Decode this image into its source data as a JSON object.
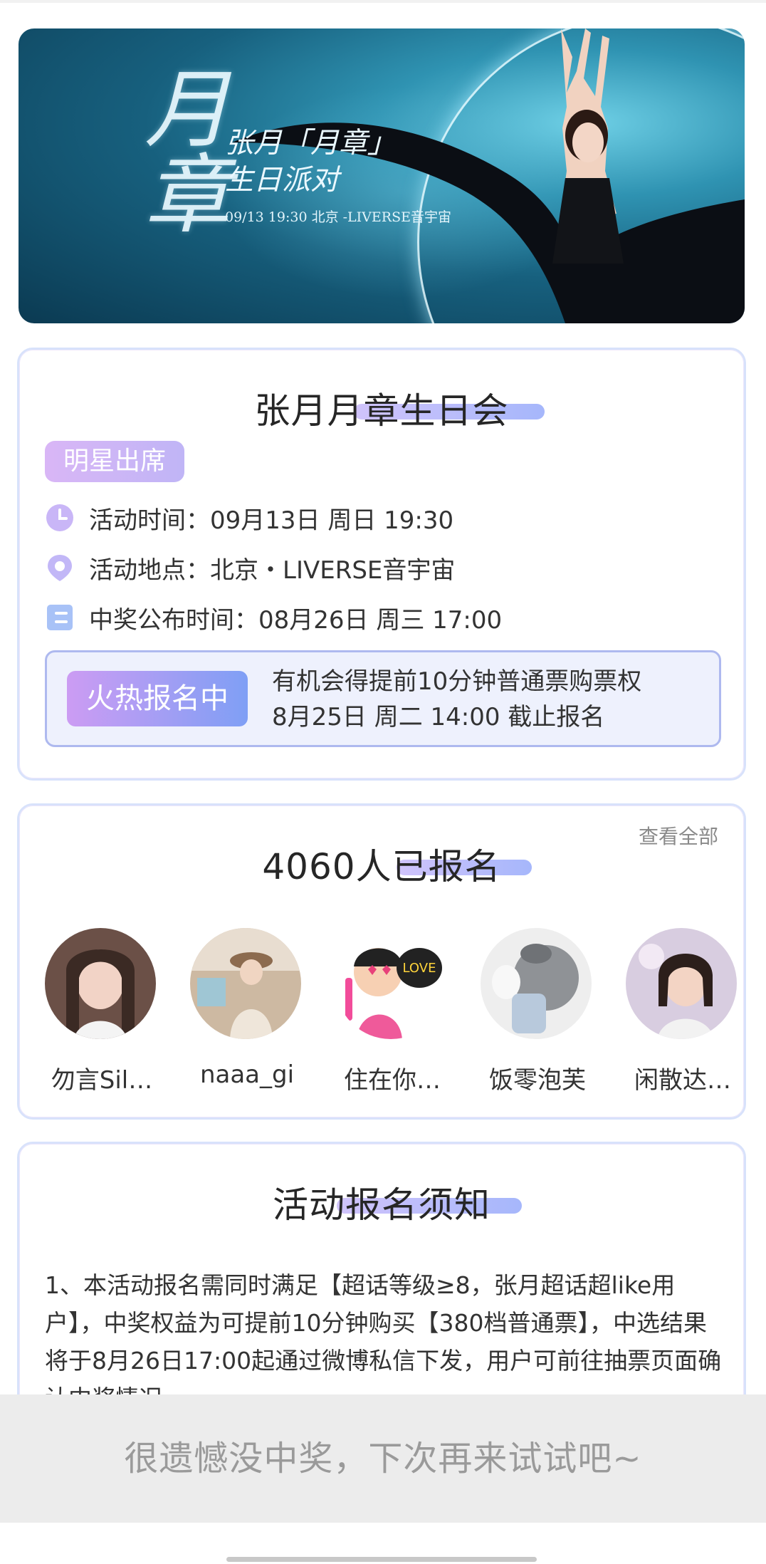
{
  "banner": {
    "calligraphy": "月章",
    "title_line1": "张月「月章」",
    "title_line2": "生日派对",
    "info": "09/13  19:30     北京 -LIVERSE音宇宙"
  },
  "event": {
    "title": "张月月章生日会",
    "badge": "明星出席",
    "time_label": "活动时间：",
    "time_value": "09月13日 周日 19:30",
    "place_label": "活动地点：",
    "place_value": "北京・LIVERSE音宇宙",
    "announce_label": "中奖公布时间：",
    "announce_value": "08月26日 周三 17:00",
    "signup_button": "火热报名中",
    "signup_line1": "有机会得提前10分钟普通票购票权",
    "signup_line2": "8月25日 周二 14:00 截止报名"
  },
  "signed": {
    "title": "4060人已报名",
    "view_all": "查看全部",
    "users": [
      {
        "name": "勿言Sil…"
      },
      {
        "name": "naaa_gi"
      },
      {
        "name": "住在你…"
      },
      {
        "name": "饭零泡芙"
      },
      {
        "name": "闲散达…"
      }
    ]
  },
  "notice": {
    "title": "活动报名须知",
    "text": "1、本活动报名需同时满足【超话等级≥8，张月超话超like用户】，中奖权益为可提前10分钟购买【380档普通票】，中选结果将于8月26日17:00起通过微博私信下发，用户可前往抽票页面确认中奖情况。"
  },
  "bottom": {
    "message": "很遗憾没中奖，下次再来试试吧~"
  },
  "colors": {
    "accent_purple": "#c0b5f6",
    "accent_blue": "#7f9ff5",
    "card_border": "#d8e2fb",
    "bottom_bar": "#ececec"
  }
}
